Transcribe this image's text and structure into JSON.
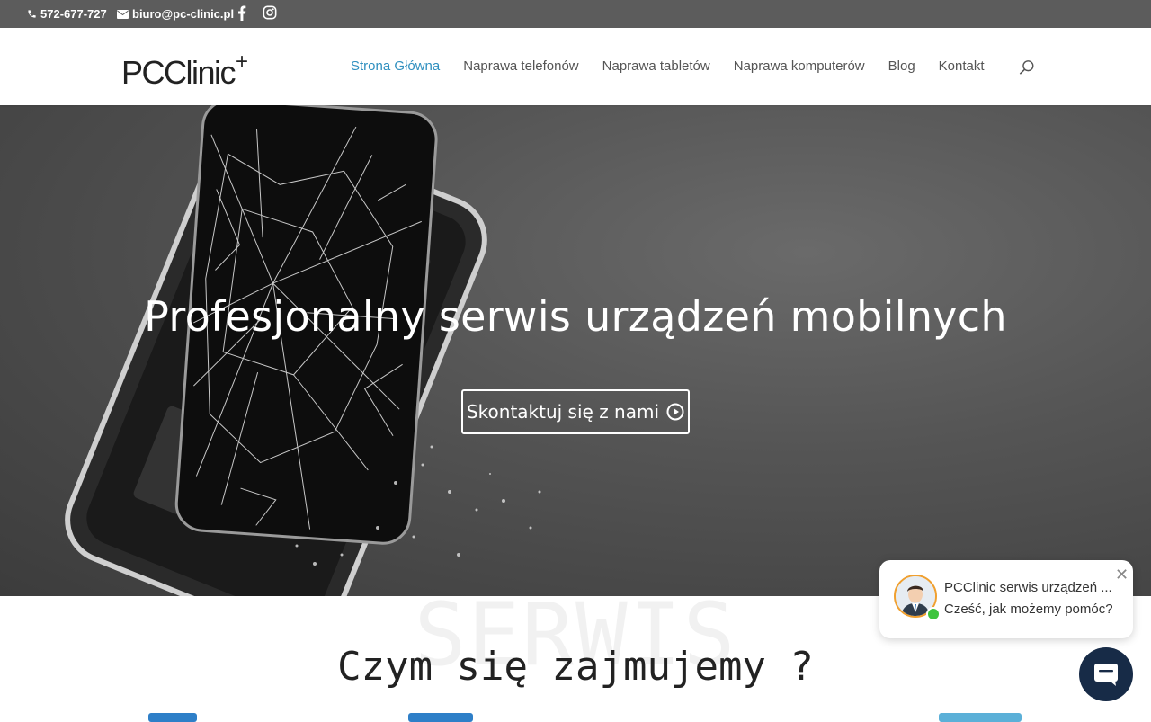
{
  "topbar": {
    "phone": "572-677-727",
    "email": "biuro@pc-clinic.pl",
    "icons": [
      "facebook-icon",
      "instagram-icon"
    ]
  },
  "header": {
    "logo_text": "PCClinic",
    "logo_sup": "+",
    "nav": [
      {
        "label": "Strona Główna",
        "active": true
      },
      {
        "label": "Naprawa telefonów",
        "active": false
      },
      {
        "label": "Naprawa tabletów",
        "active": false
      },
      {
        "label": "Naprawa komputerów",
        "active": false
      },
      {
        "label": "Blog",
        "active": false
      },
      {
        "label": "Kontakt",
        "active": false
      }
    ],
    "search_icon": "search-icon",
    "active_color": "#2e8fbf"
  },
  "hero": {
    "title": "Profesjonalny serwis urządzeń mobilnych",
    "button_label": "Skontaktuj się z nami",
    "button_icon": "play-circle-icon"
  },
  "section": {
    "watermark": "SERWIS",
    "title": "Czym się zajmujemy ?"
  },
  "chat": {
    "name": "PCClinic serwis urządzeń ...",
    "message": "Cześć, jak możemy pomóc?",
    "close_icon": "close-icon",
    "launcher_icon": "chat-icon",
    "launcher_color": "#172b47"
  }
}
